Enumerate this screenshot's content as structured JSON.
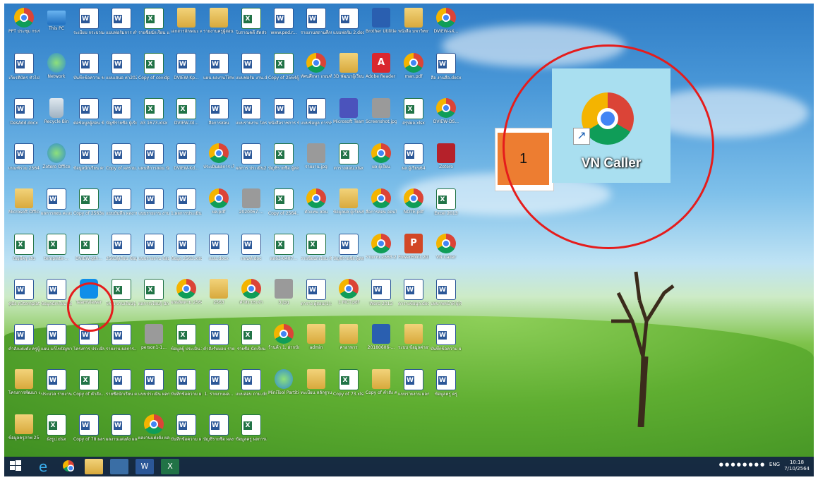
{
  "desktop": {
    "icons": [
      {
        "label": "PPT ประชุม กรเข้มแข็ง",
        "type": "chrome"
      },
      {
        "label": "This PC",
        "type": "pc"
      },
      {
        "label": "ระเบียบ กระบวนการ",
        "type": "word"
      },
      {
        "label": "แบบฟอร์มการ ดำเนินงาน",
        "type": "word"
      },
      {
        "label": "รายชื่อนักเรียน แผน.xlsx",
        "type": "excel"
      },
      {
        "label": "เอกสารลักษณะ ต่อ",
        "type": "folder"
      },
      {
        "label": "รายงานครูผู้สอน ชั้น",
        "type": "folder"
      },
      {
        "label": "โบราณคดี สัดส่วน63.xlsx",
        "type": "excel"
      },
      {
        "label": "www.ped.r...",
        "type": "word"
      },
      {
        "label": "รายงานสถานศึกษา วิชาวิทยาศาสตร์",
        "type": "word"
      },
      {
        "label": "แบบฟอร์ม 2.docx",
        "type": "word"
      },
      {
        "label": "Brother Utilities",
        "type": "blue"
      },
      {
        "label": "หนังสือ มหาวิทยาลัย",
        "type": "folder"
      },
      {
        "label": "DVIEW-sX...",
        "type": "chrome"
      },
      {
        "label": "เกียรติบัตร ทั่วไป",
        "type": "word"
      },
      {
        "label": "Network",
        "type": "net"
      },
      {
        "label": "บันทึกข้อความ ขอแต่งตั้ง",
        "type": "word"
      },
      {
        "label": "แบบเสนอ ค่า2021",
        "type": "word"
      },
      {
        "label": "Copy of covidpne...",
        "type": "excel"
      },
      {
        "label": "DVIEW-Kp...",
        "type": "word"
      },
      {
        "label": "แผน ผลงานTimeli...",
        "type": "word"
      },
      {
        "label": "แบบฟอร์ม งาน.doc",
        "type": "word"
      },
      {
        "label": "Copy of 2564ผู้เรียน...",
        "type": "excel"
      },
      {
        "label": "ทัศนศึกษา เกณฑ์",
        "type": "chrome"
      },
      {
        "label": "3D พัฒนาผู้เรียน",
        "type": "folder"
      },
      {
        "label": "Adobe Reader XI",
        "type": "pdf"
      },
      {
        "label": "man.pdf",
        "type": "chrome"
      },
      {
        "label": "สื่อ งานสื่อ.docx",
        "type": "word"
      },
      {
        "label": "DesAdd.docx",
        "type": "word"
      },
      {
        "label": "Recycle Bin",
        "type": "bin"
      },
      {
        "label": "ต่อข้อมูลผู้สอน ข้อมูล63...",
        "type": "word"
      },
      {
        "label": "บัญชีรายชื่อ ผู้เรียน",
        "type": "word"
      },
      {
        "label": "ส3 1673.xlsx",
        "type": "excel"
      },
      {
        "label": "DVIEW-Gl...",
        "type": "excel"
      },
      {
        "label": "สื่อการสอน",
        "type": "word"
      },
      {
        "label": "แบบรายงาน โครงการ.docx",
        "type": "word"
      },
      {
        "label": "หนังสือราชการ ข้อมูลพื้นฐาน",
        "type": "word"
      },
      {
        "label": "แบบข้อมูล การประเมิน",
        "type": "word"
      },
      {
        "label": "Microsoft Teams",
        "type": "team"
      },
      {
        "label": "Screenshot.jpg",
        "type": "gray"
      },
      {
        "label": "สรุปผล.xlsx",
        "type": "excel"
      },
      {
        "label": "DVIEW-DS...",
        "type": "chrome"
      },
      {
        "label": "เกณฑ์รวม 2564.docx",
        "type": "word"
      },
      {
        "label": "Zotero Office",
        "type": "net"
      },
      {
        "label": "ข้อมูลนักเรียน ความพร้อม",
        "type": "word"
      },
      {
        "label": "Copy of ผลรวม...",
        "type": "word"
      },
      {
        "label": "แผนที่การสอน นักเรียน",
        "type": "word"
      },
      {
        "label": "DVIEW-Kd...",
        "type": "word"
      },
      {
        "label": "ประเมินผลการ เรียนรู้",
        "type": "chrome"
      },
      {
        "label": "ผลการ ประเมิน2563...",
        "type": "word"
      },
      {
        "label": "บัญชีรายชื่อ ผู้สอน",
        "type": "excel"
      },
      {
        "label": "รายงาน.jpg",
        "type": "gray"
      },
      {
        "label": "ตารางสอน.xlsx",
        "type": "excel"
      },
      {
        "label": "ผล ผู้เรียน",
        "type": "chrome"
      },
      {
        "label": "ผล ผู้เรียน64",
        "type": "word"
      },
      {
        "label": "Zotero",
        "type": "red"
      },
      {
        "label": "Microsoft Office 2013",
        "type": "folder"
      },
      {
        "label": "ผลการสอน คะแนน",
        "type": "word"
      },
      {
        "label": "Copy of 2563ผลรวม...",
        "type": "excel"
      },
      {
        "label": "แบบบันทึก ผลงาน",
        "type": "word"
      },
      {
        "label": "แบบรายงาน งานวิชาการ",
        "type": "word"
      },
      {
        "label": "1.ผลการประเมิน ข้อมูลผู้สอน",
        "type": "word"
      },
      {
        "label": "ผล.pdf",
        "type": "chrome"
      },
      {
        "label": "2020067-...",
        "type": "gray"
      },
      {
        "label": "Copy of 2564...",
        "type": "excel"
      },
      {
        "label": "ตัวแทน สอน",
        "type": "chrome"
      },
      {
        "label": "ข้อมูลผล ผู้เรียนทั้งหมด",
        "type": "folder"
      },
      {
        "label": "สื่อการสอน ออนไลน์DVI...",
        "type": "chrome"
      },
      {
        "label": "NOTE.pdf",
        "type": "chrome"
      },
      {
        "label": "Excel 2013",
        "type": "excel"
      },
      {
        "label": "บัญชีครู เงิน",
        "type": "excel"
      },
      {
        "label": "template-...",
        "type": "excel"
      },
      {
        "label": "DVIEW-gth...",
        "type": "excel"
      },
      {
        "label": "2563ผู้เรียน ข้อมูลผู้สอน",
        "type": "word"
      },
      {
        "label": "แบบรายงาน ข้อมูล",
        "type": "word"
      },
      {
        "label": "ข้อมูล 2563.xlsx",
        "type": "word"
      },
      {
        "label": "แบบ.docx",
        "type": "word"
      },
      {
        "label": "เกณฑ์.doc",
        "type": "word"
      },
      {
        "label": "ผล63-0407...",
        "type": "excel"
      },
      {
        "label": "รายชื่อนักเรียน ทั้งหมด",
        "type": "excel"
      },
      {
        "label": "บัญชีรายชื่อ ผู้สอนทั้งหมด",
        "type": "word"
      },
      {
        "label": "รายงาน 2563-2564",
        "type": "chrome"
      },
      {
        "label": "PowerPoint 2013",
        "type": "ppt"
      },
      {
        "label": "VN Caller",
        "type": "chrome"
      },
      {
        "label": "คู่มือ ส3template...",
        "type": "word"
      },
      {
        "label": "ข้อมูลนักเรียน ข้อมูลครู",
        "type": "word"
      },
      {
        "label": "TeamViewer",
        "type": "tv"
      },
      {
        "label": "โครง งานเรียนรู้...",
        "type": "excel"
      },
      {
        "label": "ผลการเรียนรู้ นักเรียน",
        "type": "excel"
      },
      {
        "label": "ผลผลิตตาม 2564.pdf",
        "type": "chrome"
      },
      {
        "label": "2563",
        "type": "folder"
      },
      {
        "label": "คำสั่ง ประจำ",
        "type": "chrome"
      },
      {
        "label": "3.jpg",
        "type": "gray"
      },
      {
        "label": "ตาราง ผู้สอน(1).docx",
        "type": "word"
      },
      {
        "label": "1 MCT.pdf",
        "type": "chrome"
      },
      {
        "label": "Word 2013",
        "type": "word"
      },
      {
        "label": "ตารางข้อมูล.docx",
        "type": "word"
      },
      {
        "label": "บทบาทหน้าที่ ผู้เรียนรู้",
        "type": "word"
      },
      {
        "label": "คำสั่งแต่งตั้ง ครูผู้สอน",
        "type": "word"
      },
      {
        "label": "แผน แก้ไขปัญหา 2 ผล63.docx",
        "type": "word"
      },
      {
        "label": "โครงการ ประเมินผล",
        "type": "word"
      },
      {
        "label": "รายงาน ผลการ...",
        "type": "word"
      },
      {
        "label": "person1-1...",
        "type": "gray"
      },
      {
        "label": "ข้อมูลผู้ ประเมิน.xlsx",
        "type": "excel"
      },
      {
        "label": "คำสั่งรับมอบ รายงานผล",
        "type": "word"
      },
      {
        "label": "รายชื่อ นักเรียน",
        "type": "excel"
      },
      {
        "label": "ร้านค้า 1. ฝากบัญชี.pdf",
        "type": "chrome"
      },
      {
        "label": "admin",
        "type": "folder"
      },
      {
        "label": "ค่าอาหาร",
        "type": "folder"
      },
      {
        "label": "20180606-...",
        "type": "blue"
      },
      {
        "label": "ระบบ ข้อมูลค่าอาหาร",
        "type": "folder"
      },
      {
        "label": "บันทึกข้อความ ผลการ",
        "type": "word"
      },
      {
        "label": "โครงการพัฒนา ครู",
        "type": "folder"
      },
      {
        "label": "ประมวล รายงาน",
        "type": "word"
      },
      {
        "label": "Copy of คำสั่ง...",
        "type": "excel"
      },
      {
        "label": "รายชื่อนักเรียน ผลการเรียน",
        "type": "word"
      },
      {
        "label": "แบบประเมิน ผลการเรียนรู้",
        "type": "word"
      },
      {
        "label": "บันทึกข้อความ ผลการ...",
        "type": "word"
      },
      {
        "label": "1. รายงานผล...",
        "type": "word"
      },
      {
        "label": "แบบสอบ ถาม.docx",
        "type": "word"
      },
      {
        "label": "MiniTool Partition...",
        "type": "net"
      },
      {
        "label": "ทะเบียน หลักฐาน",
        "type": "folder"
      },
      {
        "label": "Copy of 73.xlsx",
        "type": "excel"
      },
      {
        "label": "Copy of คำสั่ง ค่าอาหาร",
        "type": "folder"
      },
      {
        "label": "แบบรายงาน ผลการเรียน",
        "type": "word"
      },
      {
        "label": "ข้อมูลครู ครู",
        "type": "word"
      },
      {
        "label": "ข้อมูลครูภาพ 2563",
        "type": "folder"
      },
      {
        "label": "ผังรูป.xlsx",
        "type": "excel"
      },
      {
        "label": "Copy of 78 ผลรวม...",
        "type": "word"
      },
      {
        "label": "ผลงานแต่งตั้ง ผลงาน",
        "type": "word"
      },
      {
        "label": "ผลงานแต่งตั้ง ผลการประเมิน",
        "type": "chrome"
      },
      {
        "label": "บันทึกข้อความ ผลการ...",
        "type": "word"
      },
      {
        "label": "บัญชีรายชื่อ ผลงาน",
        "type": "word"
      },
      {
        "label": "ข้อมูลครู ผลการเรียน",
        "type": "excel"
      }
    ]
  },
  "callout": {
    "number": "1",
    "zoom_label": "VN Caller"
  },
  "taskbar": {
    "language": "ENG",
    "time": "10:18",
    "date": "7/10/2564",
    "apps": [
      "start",
      "ie",
      "chrome",
      "explorer",
      "chrome",
      "word",
      "excel"
    ]
  },
  "colors": {
    "highlight": "#e51c1c",
    "number_box": "#ed7d31"
  }
}
